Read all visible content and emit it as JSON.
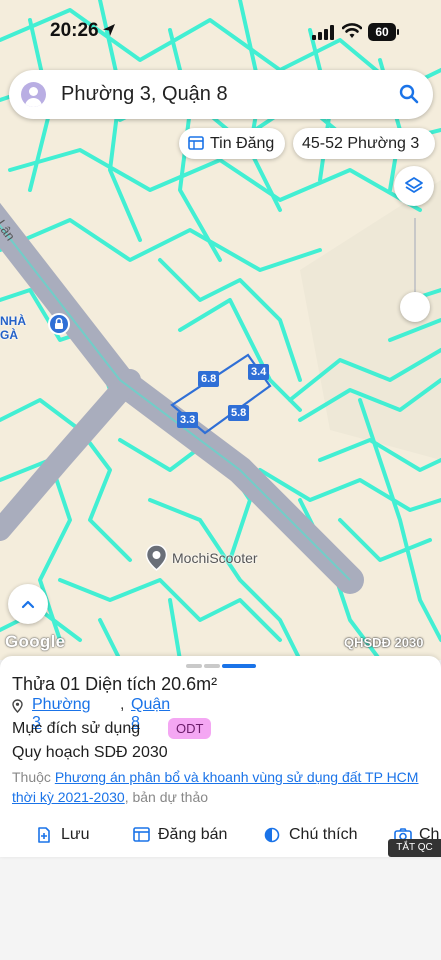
{
  "status_bar": {
    "time": "20:26",
    "battery": "60"
  },
  "search": {
    "query": "Phường 3, Quận 8"
  },
  "chips": {
    "news": "Tin Đăng",
    "address": "45-52 Phường 3"
  },
  "map": {
    "poi_gas": "NHÀ GÀ",
    "poi_scooter": "MochiScooter",
    "street": "g Lân",
    "dimensions": {
      "top": "6.8",
      "right": "3.4",
      "left": "3.3",
      "bottom": "5.8"
    },
    "attribution": "Google",
    "layer_label": "QHSDĐ 2030",
    "colors": {
      "parcel_lines": "#39f0d3",
      "road": "#a9adbd",
      "land": "#f4eddc",
      "accent": "#1a73e8"
    }
  },
  "sheet": {
    "title_prefix": "Thửa 01",
    "title_area": " Diện tích 20.6m²",
    "ward": "Phường 3",
    "comma": ",",
    "district": "Quận 8",
    "purpose_label": "Mục đích sử dụng",
    "purpose_badge": "ODT",
    "plan": "Quy hoạch SDĐ 2030",
    "source_prefix": "Thuộc ",
    "source_link": "Phương án phân bổ và khoanh vùng sử dụng đất TP HCM thời kỳ 2021-2030",
    "source_suffix": ", bản dự thảo",
    "actions": {
      "save": "Lưu",
      "sell": "Đăng bán",
      "legend": "Chú thích",
      "camera": "Ch"
    },
    "ad_label": "TẮT QC"
  }
}
